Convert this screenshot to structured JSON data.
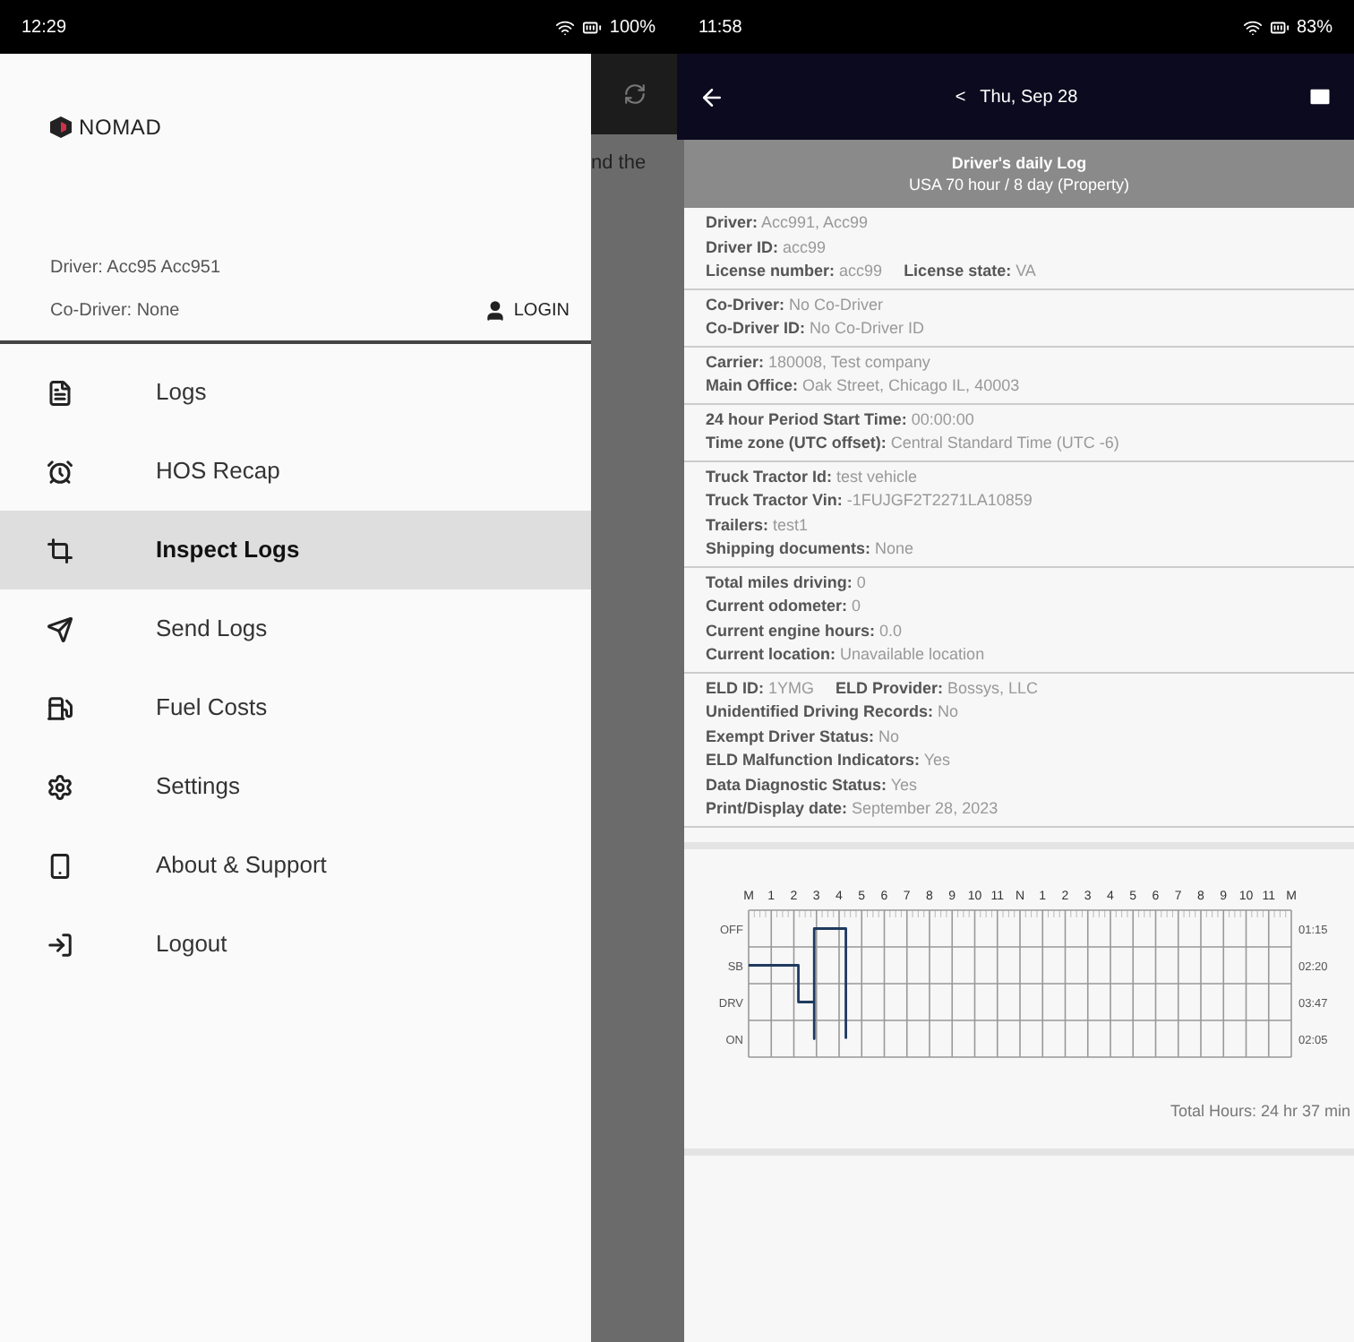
{
  "left_phone": {
    "status_bar": {
      "time": "12:29",
      "battery": "100%"
    },
    "drawer": {
      "logo": "NOMAD",
      "driver": "Driver: Acc95 Acc951",
      "co_driver": "Co-Driver: None",
      "login_button": "LOGIN",
      "items": [
        {
          "label": "Logs",
          "kind": "logs",
          "selected": false
        },
        {
          "label": "HOS Recap",
          "kind": "alarm",
          "selected": false
        },
        {
          "label": "Inspect Logs",
          "kind": "inspect",
          "selected": true
        },
        {
          "label": "Send Logs",
          "kind": "send",
          "selected": false
        },
        {
          "label": "Fuel Costs",
          "kind": "fuel",
          "selected": false
        },
        {
          "label": "Settings",
          "kind": "settings",
          "selected": false
        },
        {
          "label": "About & Support",
          "kind": "phone",
          "selected": false
        },
        {
          "label": "Logout",
          "kind": "logout",
          "selected": false
        }
      ]
    },
    "background_text": "nd the"
  },
  "right_phone": {
    "status_bar": {
      "time": "11:58",
      "battery": "83%"
    },
    "app_bar": {
      "prev": "<",
      "date": "Thu, Sep 28"
    },
    "header": {
      "title": "Driver's daily Log",
      "subtitle": "USA 70 hour / 8 day (Property)"
    },
    "sections": [
      {
        "lines": [
          [
            "**Driver:** Acc991, Acc99"
          ],
          [
            "**Driver ID:** acc99"
          ],
          [
            "**License number:** acc99",
            "**License state:** VA"
          ]
        ]
      },
      {
        "lines": [
          [
            "**Co-Driver:** No Co-Driver"
          ],
          [
            "**Co-Driver ID:** No Co-Driver ID"
          ]
        ]
      },
      {
        "lines": [
          [
            "**Carrier:** 180008, Test company"
          ],
          [
            "**Main Office:** Oak Street, Chicago IL, 40003"
          ]
        ]
      },
      {
        "lines": [
          [
            "**24 hour Period Start Time:** 00:00:00"
          ],
          [
            "**Time zone (UTC offset):** Central Standard Time (UTC -6)"
          ]
        ]
      },
      {
        "lines": [
          [
            "**Truck Tractor Id:** test vehicle"
          ],
          [
            "**Truck Tractor Vin:** -1FUJGF2T2271LA10859"
          ],
          [
            "**Trailers:** test1"
          ],
          [
            "**Shipping documents:** None"
          ]
        ]
      },
      {
        "lines": [
          [
            "**Total miles driving:** 0"
          ],
          [
            "**Current odometer:** 0"
          ],
          [
            "**Current engine hours:** 0.0"
          ],
          [
            "**Current location:** Unavailable location"
          ]
        ]
      },
      {
        "lines": [
          [
            "**ELD ID:** 1YMG",
            "**ELD Provider:** Bossys, LLC"
          ],
          [
            "**Unidentified Driving Records:** No"
          ],
          [
            "**Exempt Driver Status:** No"
          ],
          [
            "**ELD Malfunction Indicators:** Yes"
          ],
          [
            "**Data Diagnostic Status:** Yes"
          ],
          [
            "**Print/Display date:** September 28, 2023"
          ]
        ]
      }
    ],
    "log_chart": {
      "hour_labels": [
        "M",
        "1",
        "2",
        "3",
        "4",
        "5",
        "6",
        "7",
        "8",
        "9",
        "10",
        "11",
        "N",
        "1",
        "2",
        "3",
        "4",
        "5",
        "6",
        "7",
        "8",
        "9",
        "10",
        "11",
        "M"
      ],
      "status_labels": [
        "OFF",
        "SB",
        "DRV",
        "ON"
      ],
      "totals": [
        "01:15",
        "02:20",
        "03:47",
        "02:05"
      ],
      "total_hours": "Total Hours: 24 hr 37 min"
    }
  }
}
